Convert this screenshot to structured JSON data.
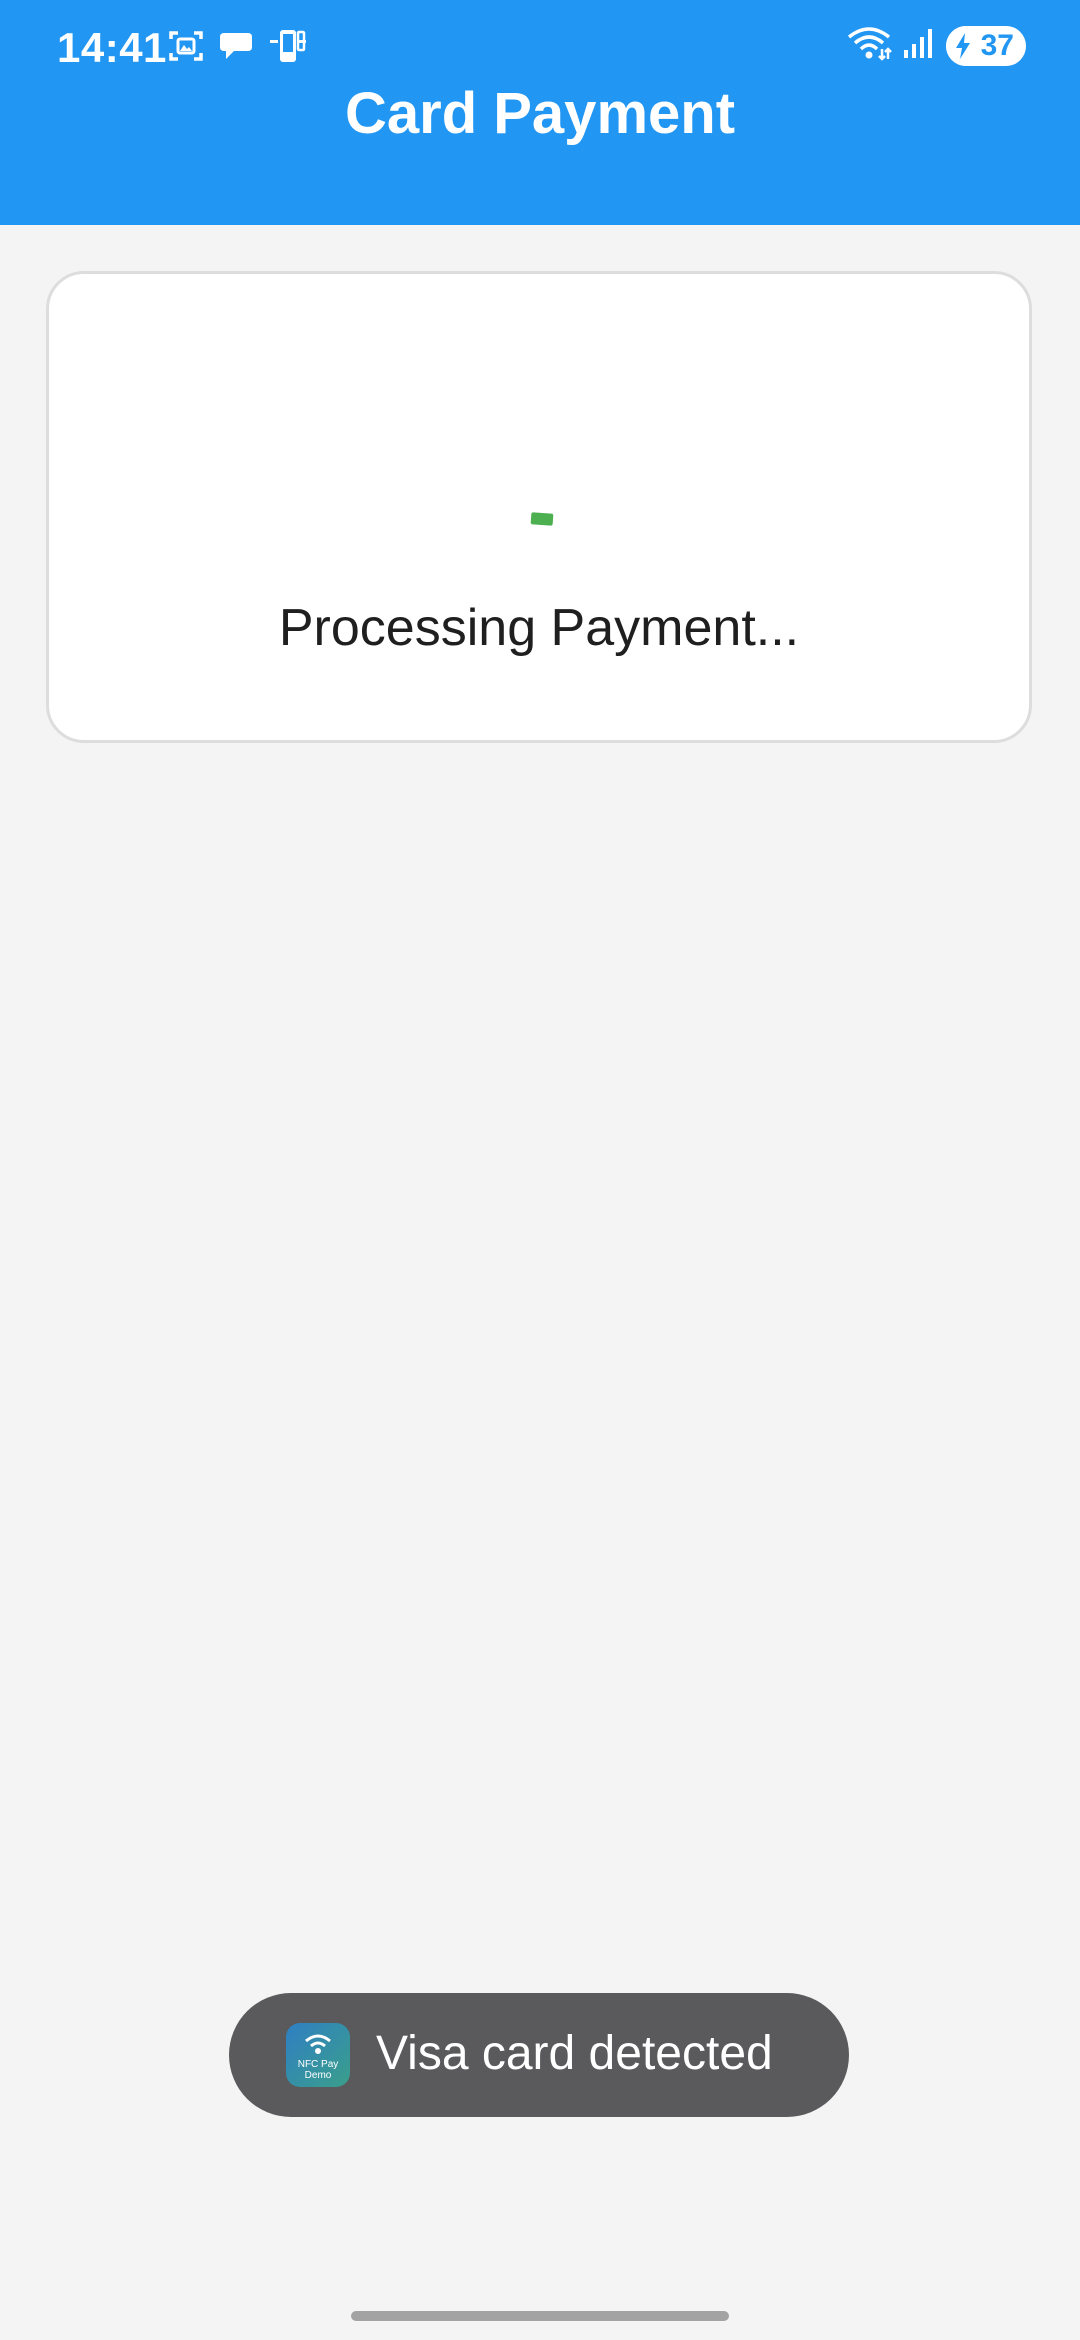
{
  "status_bar": {
    "time": "14:41",
    "battery_level": "37",
    "left_icons": [
      "screenshot-icon",
      "chat-bubble-icon",
      "nfc-phone-icon"
    ],
    "right_icons": [
      "wifi-icon",
      "signal-icon",
      "battery-charging-icon"
    ]
  },
  "app_bar": {
    "title": "Card Payment",
    "color": "#2196f3"
  },
  "payment_card": {
    "status_text": "Processing Payment...",
    "spinner_color": "#4caf50"
  },
  "toast": {
    "app_icon_label": "NFC Pay Demo",
    "message": "Visa card detected"
  }
}
